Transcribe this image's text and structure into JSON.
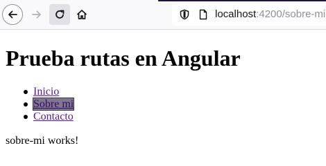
{
  "browser": {
    "url_host": "localhost",
    "url_port_path": ":4200/sobre-mi"
  },
  "page": {
    "title": "Prueba rutas en Angular",
    "nav": [
      {
        "label": "Inicio",
        "active": false
      },
      {
        "label": "Sobre mi",
        "active": true
      },
      {
        "label": "Contacto",
        "active": false
      }
    ],
    "message": "sobre-mi works!"
  },
  "icons": [
    "back-arrow-icon",
    "forward-arrow-icon",
    "reload-icon",
    "home-icon",
    "shield-icon",
    "page-icon"
  ],
  "colors": {
    "link": "#551a8b",
    "active_highlight": "#7f778f"
  }
}
